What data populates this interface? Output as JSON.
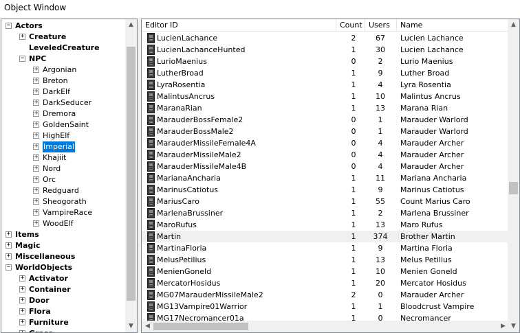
{
  "window": {
    "title": "Object Window"
  },
  "tree": {
    "nodes": [
      {
        "label": "Actors",
        "toggle": "−",
        "bold": true
      },
      {
        "label": "Creature",
        "toggle": "+",
        "bold": true
      },
      {
        "label": "LeveledCreature",
        "toggle": "",
        "bold": true
      },
      {
        "label": "NPC",
        "toggle": "−",
        "bold": true
      },
      {
        "label": "Argonian",
        "toggle": "+",
        "bold": false
      },
      {
        "label": "Breton",
        "toggle": "+",
        "bold": false
      },
      {
        "label": "DarkElf",
        "toggle": "+",
        "bold": false
      },
      {
        "label": "DarkSeducer",
        "toggle": "+",
        "bold": false
      },
      {
        "label": "Dremora",
        "toggle": "+",
        "bold": false
      },
      {
        "label": "GoldenSaint",
        "toggle": "+",
        "bold": false
      },
      {
        "label": "HighElf",
        "toggle": "+",
        "bold": false
      },
      {
        "label": "Imperial",
        "toggle": "+",
        "bold": false,
        "selected": true
      },
      {
        "label": "Khajiit",
        "toggle": "+",
        "bold": false
      },
      {
        "label": "Nord",
        "toggle": "+",
        "bold": false
      },
      {
        "label": "Orc",
        "toggle": "+",
        "bold": false
      },
      {
        "label": "Redguard",
        "toggle": "+",
        "bold": false
      },
      {
        "label": "Sheogorath",
        "toggle": "+",
        "bold": false
      },
      {
        "label": "VampireRace",
        "toggle": "+",
        "bold": false
      },
      {
        "label": "WoodElf",
        "toggle": "+",
        "bold": false
      },
      {
        "label": "Items",
        "toggle": "+",
        "bold": true
      },
      {
        "label": "Magic",
        "toggle": "+",
        "bold": true
      },
      {
        "label": "Miscellaneous",
        "toggle": "+",
        "bold": true
      },
      {
        "label": "WorldObjects",
        "toggle": "−",
        "bold": true
      },
      {
        "label": "Activator",
        "toggle": "+",
        "bold": true
      },
      {
        "label": "Container",
        "toggle": "+",
        "bold": true
      },
      {
        "label": "Door",
        "toggle": "+",
        "bold": true
      },
      {
        "label": "Flora",
        "toggle": "+",
        "bold": true
      },
      {
        "label": "Furniture",
        "toggle": "+",
        "bold": true
      },
      {
        "label": "Grass",
        "toggle": "+",
        "bold": true
      }
    ]
  },
  "list": {
    "columns": [
      "Editor ID",
      "Count",
      "Users",
      "Name"
    ],
    "rows": [
      {
        "id": "LucienLachance",
        "count": "2",
        "users": "67",
        "name": "Lucien Lachance"
      },
      {
        "id": "LucienLachanceHunted",
        "count": "1",
        "users": "30",
        "name": "Lucien Lachance"
      },
      {
        "id": "LurioMaenius",
        "count": "0",
        "users": "2",
        "name": "Lurio Maenius"
      },
      {
        "id": "LutherBroad",
        "count": "1",
        "users": "9",
        "name": "Luther Broad"
      },
      {
        "id": "LyraRosentia",
        "count": "1",
        "users": "4",
        "name": "Lyra Rosentia"
      },
      {
        "id": "MalintusAncrus",
        "count": "1",
        "users": "10",
        "name": "Malintus Ancrus"
      },
      {
        "id": "MaranaRian",
        "count": "1",
        "users": "13",
        "name": "Marana Rian"
      },
      {
        "id": "MarauderBossFemale2",
        "count": "0",
        "users": "1",
        "name": "Marauder Warlord"
      },
      {
        "id": "MarauderBossMale2",
        "count": "0",
        "users": "1",
        "name": "Marauder Warlord"
      },
      {
        "id": "MarauderMissileFemale4A",
        "count": "0",
        "users": "4",
        "name": "Marauder Archer"
      },
      {
        "id": "MarauderMissileMale2",
        "count": "0",
        "users": "4",
        "name": "Marauder Archer"
      },
      {
        "id": "MarauderMissileMale4B",
        "count": "0",
        "users": "4",
        "name": "Marauder Archer"
      },
      {
        "id": "MarianaAncharia",
        "count": "1",
        "users": "11",
        "name": "Mariana Ancharia"
      },
      {
        "id": "MarinusCatiotus",
        "count": "1",
        "users": "9",
        "name": "Marinus Catiotus"
      },
      {
        "id": "MariusCaro",
        "count": "1",
        "users": "55",
        "name": "Count Marius Caro"
      },
      {
        "id": "MarlenaBrussiner",
        "count": "1",
        "users": "2",
        "name": "Marlena Brussiner"
      },
      {
        "id": "MaroRufus",
        "count": "1",
        "users": "13",
        "name": "Maro Rufus"
      },
      {
        "id": "Martin",
        "count": "1",
        "users": "374",
        "name": "Brother Martin",
        "highlight": true
      },
      {
        "id": "MartinaFloria",
        "count": "1",
        "users": "9",
        "name": "Martina Floria"
      },
      {
        "id": "MelusPetilius",
        "count": "1",
        "users": "13",
        "name": "Melus Petilius"
      },
      {
        "id": "MenienGoneld",
        "count": "1",
        "users": "10",
        "name": "Menien Goneld"
      },
      {
        "id": "MercatorHosidus",
        "count": "1",
        "users": "20",
        "name": "Mercator Hosidus"
      },
      {
        "id": "MG07MarauderMissileMale2",
        "count": "2",
        "users": "0",
        "name": "Marauder Archer"
      },
      {
        "id": "MG13Vampire01Warrior",
        "count": "1",
        "users": "1",
        "name": "Bloodcrust Vampire"
      },
      {
        "id": "MG17Necromancer01a",
        "count": "1",
        "users": "0",
        "name": "Necromancer"
      }
    ]
  },
  "scroll": {
    "up": "▲",
    "down": "▼",
    "left": "◀",
    "right": "▶"
  },
  "colors": {
    "selection": "#0078d7",
    "border": "#828790",
    "scroll_thumb": "#c1c1c1"
  }
}
